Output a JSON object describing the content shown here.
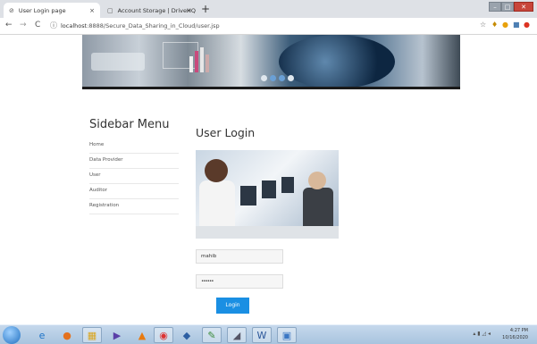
{
  "browser": {
    "tabs": [
      {
        "title": "User Login page",
        "icon": "globe-icon",
        "close": "×"
      },
      {
        "title": "Account Storage | DriveHQ",
        "icon": "page-icon",
        "close": "×"
      }
    ],
    "new_tab": "+",
    "url_host": "localhost",
    "url_rest": ":8888/Secure_Data_Sharing_in_Cloud/user.jsp",
    "nav": {
      "back": "←",
      "forward": "→",
      "reload": "C"
    },
    "window_controls": {
      "min": "–",
      "max": "□",
      "close": "✕"
    }
  },
  "sidebar": {
    "title": "Sidebar Menu",
    "items": [
      {
        "label": "Home"
      },
      {
        "label": "Data Provider"
      },
      {
        "label": "User"
      },
      {
        "label": "Auditor"
      },
      {
        "label": "Registration"
      }
    ]
  },
  "login": {
    "title": "User Login",
    "username_value": "mahib",
    "password_value": "••••••",
    "button": "Login"
  },
  "taskbar": {
    "time": "4:27 PM",
    "date": "10/16/2020",
    "apps": [
      "ie-icon",
      "firefox-icon",
      "explorer-icon",
      "media-player-icon",
      "vlc-icon",
      "chrome-icon",
      "virtualbox-icon",
      "paint-icon",
      "calc-icon",
      "word-icon",
      "app-icon"
    ]
  },
  "colors": {
    "accent": "#1a8fe3",
    "taskbar": "#b7d0e8"
  }
}
